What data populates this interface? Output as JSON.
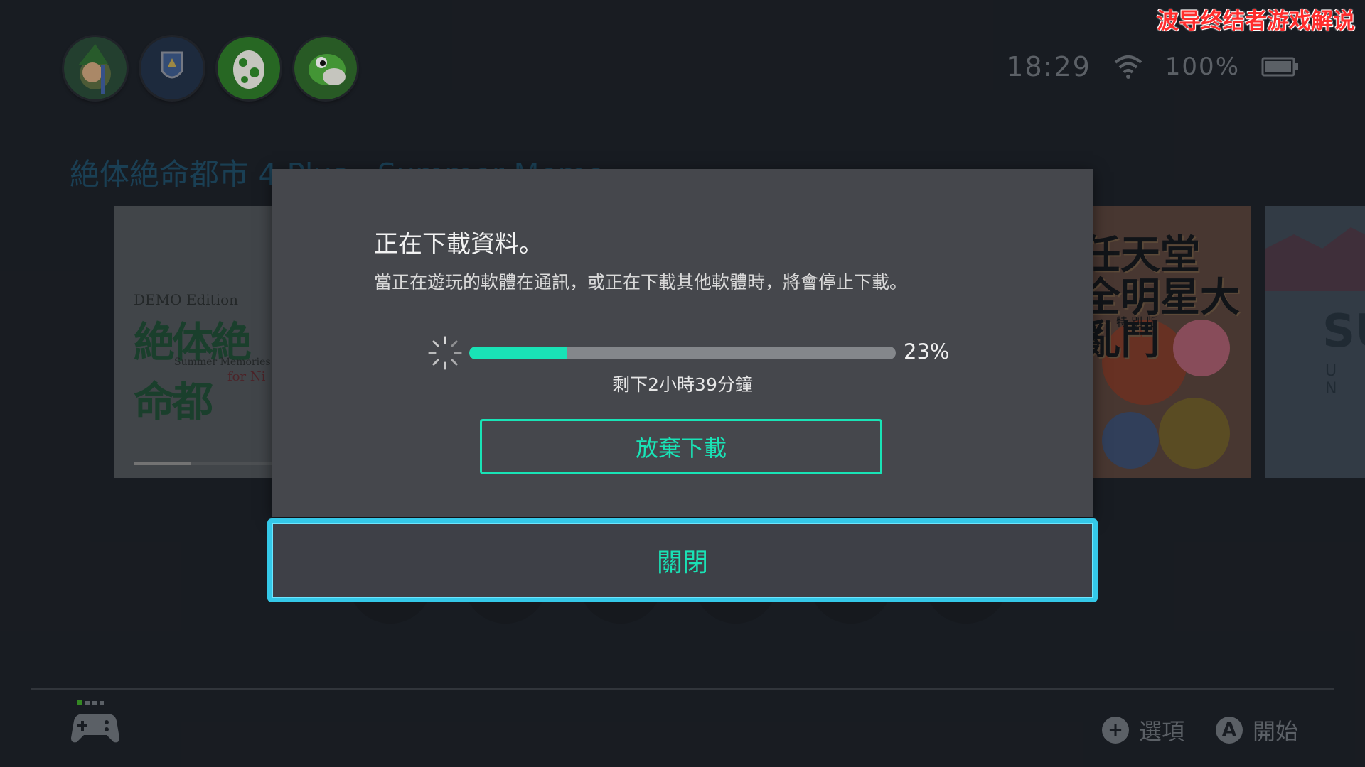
{
  "watermark": "波导终结者游戏解说",
  "user_avatars": [
    "link-avatar",
    "shield-avatar",
    "yoshi-egg-avatar",
    "yoshi-avatar"
  ],
  "status_bar": {
    "time": "18:29",
    "battery": "100%"
  },
  "home": {
    "selected_game_title": "絶体絶命都市 4 Plus - Summer Memo",
    "tiles": {
      "demo": {
        "edition": "DEMO Edition",
        "logo": "絶体絶命都",
        "subtitle": "Summer Memories",
        "tag": "for Ni"
      },
      "smash": {
        "title_line1": "任天堂",
        "title_line2": "全明星大亂鬥",
        "subtitle": "特 別 版"
      },
      "third": {
        "big": "SU",
        "small": "U N"
      }
    }
  },
  "dialog": {
    "title": "正在下載資料。",
    "message": "當正在遊玩的軟體在通訊，或正在下載其他軟體時，將會停止下載。",
    "progress": 0.23,
    "progress_label": "23%",
    "remaining": "剩下2小時39分鐘",
    "cancel_label": "放棄下載",
    "close_label": "關閉"
  },
  "footer": {
    "options_label": "選項",
    "start_label": "開始"
  },
  "colors": {
    "accent": "#19e3b6",
    "focus": "#34c8e8"
  }
}
